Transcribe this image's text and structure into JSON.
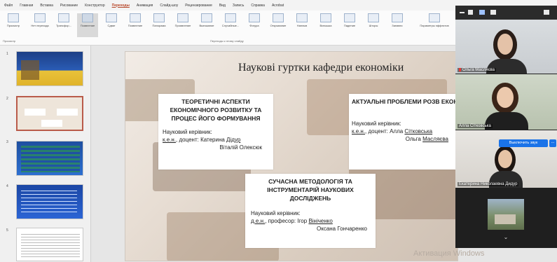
{
  "menubar": {
    "tabs": [
      "Файл",
      "Главная",
      "Вставка",
      "Рисование",
      "Конструктор",
      "Переходы",
      "Анимация",
      "Слайд-шоу",
      "Рецензирование",
      "Вид",
      "Запись",
      "Справка",
      "Acrobat"
    ],
    "active_tab": "Переходы"
  },
  "ribbon": {
    "preview_label": "Просмотр",
    "preview_group": "Просмотр",
    "transitions": [
      "Нет перехода",
      "Трансфор...",
      "Появление",
      "Сдвиг",
      "Появление",
      "Панорама",
      "Проявление",
      "Выезжание",
      "Случайные...",
      "Фигура",
      "Открывание",
      "Наплыв",
      "Вспышка",
      "Падение",
      "Шторы",
      "Занавес"
    ],
    "group_label": "Переходы к этому слайду",
    "effects_label": "Параметры эффектов"
  },
  "thumbnails": {
    "numbers": [
      "1",
      "2",
      "3",
      "4",
      "5"
    ]
  },
  "slide": {
    "title": "Наукові гуртки кафедри економіки",
    "card1": {
      "heading": "ТЕОРЕТИЧНІ АСПЕКТИ ЕКОНОМІЧНОГО РОЗВИТКУ ТА ПРОЦЕС ЙОГО ФОРМУВАННЯ",
      "role": "Науковий керівник:",
      "degree": "к.е.н.",
      "rank": ", доцент: Катерина ",
      "name1": "Дідур",
      "name2": "Віталій Олексюк"
    },
    "card2": {
      "heading": "АКТУАЛЬНІ ПРОБЛЕМИ РОЗВ ЕКОНОМІКИ",
      "role": "Науковий керівник:",
      "degree": "к.е.н.",
      "rank": ", доцент: Алла ",
      "name1": "Сітковська",
      "name2a": "Ольга ",
      "name2b": "Масляєва"
    },
    "card3": {
      "heading": "СУЧАСНА МЕТОДОЛОГІЯ ТА ІНСТРУМЕНТАРІЙ НАУКОВИХ ДОСЛІДЖЕНЬ",
      "role": "Науковий керівник:",
      "degree": "д.е.н.",
      "rank": ", професор: Ігор ",
      "name1": "Вініченко",
      "name2": "Оксана Гончаренко"
    },
    "watermark": "Активация Windows"
  },
  "zoom": {
    "participants": [
      {
        "name": "Ольга Масляєва"
      },
      {
        "name": "Алла Сітковська"
      },
      {
        "name": "Екатерина Николаевна Дидур"
      }
    ],
    "unmute_label": "Выключить звук",
    "more_label": "..."
  }
}
